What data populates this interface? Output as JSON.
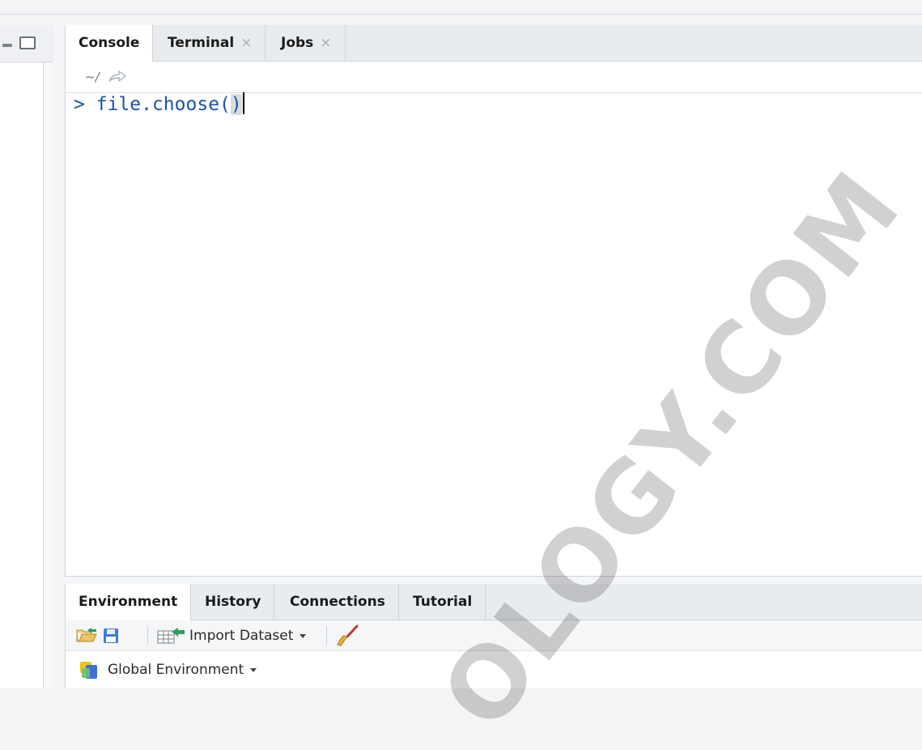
{
  "console_pane": {
    "tabs": [
      {
        "label": "Console",
        "active": true,
        "closable": false
      },
      {
        "label": "Terminal",
        "active": false,
        "closable": true
      },
      {
        "label": "Jobs",
        "active": false,
        "closable": true
      }
    ],
    "close_glyph": "×",
    "working_dir": "~/",
    "prompt": ">",
    "command_text": "file.choose(",
    "command_close_paren": ")"
  },
  "env_pane": {
    "tabs": [
      {
        "label": "Environment",
        "active": true
      },
      {
        "label": "History",
        "active": false
      },
      {
        "label": "Connections",
        "active": false
      },
      {
        "label": "Tutorial",
        "active": false
      }
    ],
    "toolbar": {
      "import_dataset_label": "Import Dataset",
      "icons": [
        "open-folder-icon",
        "save-icon",
        "import-dataset-icon",
        "broom-icon"
      ]
    },
    "env_selector_label": "Global Environment"
  },
  "watermark_text": "OLOGY.COM",
  "colors": {
    "accent_code": "#1a54a4",
    "tab_bar_bg": "#e9ecef",
    "border": "#cfd3d8"
  }
}
